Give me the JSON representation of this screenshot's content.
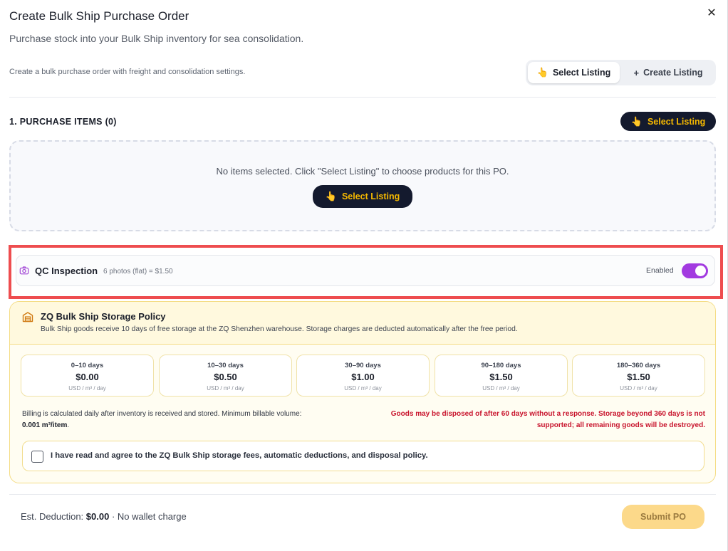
{
  "modal": {
    "title": "Create Bulk Ship Purchase Order",
    "subtitle": "Purchase stock into your Bulk Ship inventory for sea consolidation.",
    "description": "Create a bulk purchase order with freight and consolidation settings.",
    "close_glyph": "✕"
  },
  "mode_switch": {
    "select_label": "Select Listing",
    "create_label": "Create Listing",
    "select_icon": "👆",
    "create_icon": "+"
  },
  "purchase_items": {
    "section_title": "1. PURCHASE ITEMS (0)",
    "select_button_label": "Select Listing",
    "button_icon": "👆",
    "empty_text": "No items selected. Click \"Select Listing\" to choose products for this PO.",
    "empty_button_label": "Select Listing"
  },
  "qc_inspection": {
    "title": "QC Inspection",
    "detail": "6 photos (flat) = $1.50",
    "status_label": "Enabled",
    "enabled": true,
    "accent_color": "#a23ae0",
    "icon": "camera-icon"
  },
  "storage_policy": {
    "title": "ZQ Bulk Ship Storage Policy",
    "subtitle": "Bulk Ship goods receive 10 days of free storage at the ZQ Shenzhen warehouse. Storage charges are deducted automatically after the free period.",
    "icon": "warehouse-icon",
    "tiers": [
      {
        "range": "0–10 days",
        "price": "$0.00",
        "unit": "USD / m³ / day"
      },
      {
        "range": "10–30 days",
        "price": "$0.50",
        "unit": "USD / m³ / day"
      },
      {
        "range": "30–90 days",
        "price": "$1.00",
        "unit": "USD / m³ / day"
      },
      {
        "range": "90–180 days",
        "price": "$1.50",
        "unit": "USD / m³ / day"
      },
      {
        "range": "180–360 days",
        "price": "$1.50",
        "unit": "USD / m³ / day"
      }
    ],
    "billing_text": "Billing is calculated daily after inventory is received and stored. Minimum billable volume:",
    "billing_min_volume": "0.001 m³/item",
    "billing_end": ".",
    "warning_text": "Goods may be disposed of after 60 days without a response. Storage beyond 360 days is not supported; all remaining goods will be destroyed.",
    "agree_label": "I have read and agree to the ZQ Bulk Ship storage fees, automatic deductions, and disposal policy.",
    "agree_checked": false
  },
  "footer": {
    "est_label": "Est. Deduction:",
    "est_value": "$0.00",
    "est_note": "· No wallet charge",
    "submit_label": "Submit PO"
  }
}
